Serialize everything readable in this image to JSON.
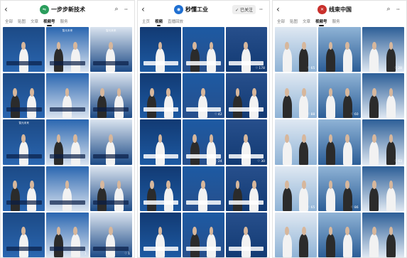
{
  "colors": {
    "tile_blue": "#1f4f8f",
    "tile_deep": "#15356b",
    "tile_light": "#d7e2ee",
    "accent_yellow": "#f1c232",
    "accent_red": "#d62b2b",
    "logo_green": "#2a9d5c",
    "logo_blue": "#1f6fd1",
    "logo_red": "#c9302c"
  },
  "phones": [
    {
      "title": "一步步新技术",
      "logo_icon": "channel-logo-icon",
      "tabs": [
        {
          "label": "全部",
          "active": false
        },
        {
          "label": "贴图",
          "active": false
        },
        {
          "label": "文章",
          "active": false
        },
        {
          "label": "视频号",
          "active": true
        },
        {
          "label": "服务",
          "active": false
        }
      ],
      "show_search": true,
      "show_more": true,
      "tiles": [
        {
          "top": "",
          "bottom": "",
          "count": ""
        },
        {
          "top": "智元未来",
          "bottom": "",
          "count": ""
        },
        {
          "top": "智元未来",
          "bottom": "",
          "count": ""
        },
        {
          "top": "",
          "bottom": "",
          "count": ""
        },
        {
          "top": "",
          "bottom": "",
          "count": ""
        },
        {
          "top": "",
          "bottom": "",
          "count": ""
        },
        {
          "top": "智元未来",
          "bottom": "",
          "count": ""
        },
        {
          "top": "",
          "bottom": "",
          "count": ""
        },
        {
          "top": "",
          "bottom": "",
          "count": ""
        },
        {
          "top": "",
          "bottom": "",
          "count": ""
        },
        {
          "top": "",
          "bottom": "",
          "count": ""
        },
        {
          "top": "",
          "bottom": "",
          "count": ""
        },
        {
          "top": "",
          "bottom": "",
          "count": ""
        },
        {
          "top": "",
          "bottom": "",
          "count": "1"
        },
        {
          "top": "",
          "bottom": "",
          "count": "1"
        }
      ]
    },
    {
      "title": "秒懂工业",
      "logo_icon": "channel-logo-icon",
      "follow_label": "✓ 已关注",
      "tabs": [
        {
          "label": "主页",
          "active": false
        },
        {
          "label": "视频",
          "active": true
        },
        {
          "label": "直播回放",
          "active": false
        }
      ],
      "show_search": false,
      "show_more": true,
      "tiles": [
        {
          "top": "",
          "bottom": "",
          "count": ""
        },
        {
          "top": "",
          "bottom": "",
          "count": ""
        },
        {
          "top": "",
          "bottom": "",
          "count": "178"
        },
        {
          "top": "",
          "bottom": "",
          "count": ""
        },
        {
          "top": "",
          "bottom": "",
          "count": "42"
        },
        {
          "top": "",
          "bottom": "",
          "count": ""
        },
        {
          "top": "",
          "bottom": "",
          "count": ""
        },
        {
          "top": "",
          "bottom": "",
          "count": "24"
        },
        {
          "top": "",
          "bottom": "",
          "count": "30"
        },
        {
          "top": "",
          "bottom": "",
          "count": ""
        },
        {
          "top": "",
          "bottom": "",
          "count": ""
        },
        {
          "top": "",
          "bottom": "",
          "count": ""
        },
        {
          "top": "",
          "bottom": "",
          "count": ""
        },
        {
          "top": "",
          "bottom": "",
          "count": ""
        },
        {
          "top": "",
          "bottom": "",
          "count": ""
        }
      ]
    },
    {
      "title": "线束中国",
      "logo_icon": "channel-logo-icon",
      "tabs": [
        {
          "label": "全部",
          "active": false
        },
        {
          "label": "贴图",
          "active": false
        },
        {
          "label": "文章",
          "active": false
        },
        {
          "label": "视频号",
          "active": true
        },
        {
          "label": "服务",
          "active": false
        }
      ],
      "show_search": true,
      "show_more": true,
      "tiles": [
        {
          "top": "",
          "bottom": "",
          "count": "65"
        },
        {
          "top": "",
          "bottom": "",
          "count": ""
        },
        {
          "top": "",
          "bottom": "",
          "count": "28"
        },
        {
          "top": "",
          "bottom": "",
          "count": "88"
        },
        {
          "top": "",
          "bottom": "",
          "count": "60"
        },
        {
          "top": "",
          "bottom": "",
          "count": ""
        },
        {
          "top": "",
          "bottom": "",
          "count": ""
        },
        {
          "top": "",
          "bottom": "",
          "count": ""
        },
        {
          "top": "",
          "bottom": "",
          "count": "63"
        },
        {
          "top": "",
          "bottom": "",
          "count": "65"
        },
        {
          "top": "",
          "bottom": "",
          "count": "86"
        },
        {
          "top": "",
          "bottom": "",
          "count": ""
        },
        {
          "top": "",
          "bottom": "",
          "count": ""
        },
        {
          "top": "",
          "bottom": "",
          "count": ""
        },
        {
          "top": "",
          "bottom": "",
          "count": ""
        }
      ]
    }
  ]
}
